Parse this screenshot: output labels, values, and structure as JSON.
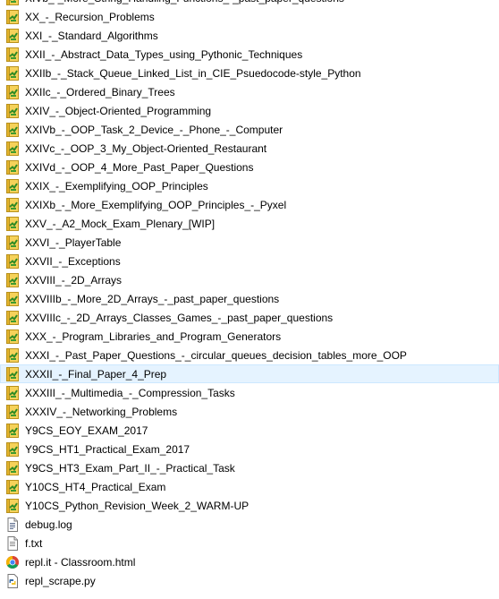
{
  "files": [
    {
      "name": "XIVb_-_More_String_Handling_Functions_-_past_paper_questions",
      "icon": "notebook-icon",
      "selected": false
    },
    {
      "name": "XX_-_Recursion_Problems",
      "icon": "notebook-icon",
      "selected": false
    },
    {
      "name": "XXI_-_Standard_Algorithms",
      "icon": "notebook-icon",
      "selected": false
    },
    {
      "name": "XXII_-_Abstract_Data_Types_using_Pythonic_Techniques",
      "icon": "notebook-icon",
      "selected": false
    },
    {
      "name": "XXIIb_-_Stack_Queue_Linked_List_in_CIE_Psuedocode-style_Python",
      "icon": "notebook-icon",
      "selected": false
    },
    {
      "name": "XXIIc_-_Ordered_Binary_Trees",
      "icon": "notebook-icon",
      "selected": false
    },
    {
      "name": "XXIV_-_Object-Oriented_Programming",
      "icon": "notebook-icon",
      "selected": false
    },
    {
      "name": "XXIVb_-_OOP_Task_2_Device_-_Phone_-_Computer",
      "icon": "notebook-icon",
      "selected": false
    },
    {
      "name": "XXIVc_-_OOP_3_My_Object-Oriented_Restaurant",
      "icon": "notebook-icon",
      "selected": false
    },
    {
      "name": "XXIVd_-_OOP_4_More_Past_Paper_Questions",
      "icon": "notebook-icon",
      "selected": false
    },
    {
      "name": "XXIX_-_Exemplifying_OOP_Principles",
      "icon": "notebook-icon",
      "selected": false
    },
    {
      "name": "XXIXb_-_More_Exemplifying_OOP_Principles_-_Pyxel",
      "icon": "notebook-icon",
      "selected": false
    },
    {
      "name": "XXV_-_A2_Mock_Exam_Plenary_[WIP]",
      "icon": "notebook-icon",
      "selected": false
    },
    {
      "name": "XXVI_-_PlayerTable",
      "icon": "notebook-icon",
      "selected": false
    },
    {
      "name": "XXVII_-_Exceptions",
      "icon": "notebook-icon",
      "selected": false
    },
    {
      "name": "XXVIII_-_2D_Arrays",
      "icon": "notebook-icon",
      "selected": false
    },
    {
      "name": "XXVIIIb_-_More_2D_Arrays_-_past_paper_questions",
      "icon": "notebook-icon",
      "selected": false
    },
    {
      "name": "XXVIIIc_-_2D_Arrays_Classes_Games_-_past_paper_questions",
      "icon": "notebook-icon",
      "selected": false
    },
    {
      "name": "XXX_-_Program_Libraries_and_Program_Generators",
      "icon": "notebook-icon",
      "selected": false
    },
    {
      "name": "XXXI_-_Past_Paper_Questions_-_circular_queues_decision_tables_more_OOP",
      "icon": "notebook-icon",
      "selected": false
    },
    {
      "name": "XXXII_-_Final_Paper_4_Prep",
      "icon": "notebook-icon",
      "selected": true
    },
    {
      "name": "XXXIII_-_Multimedia_-_Compression_Tasks",
      "icon": "notebook-icon",
      "selected": false
    },
    {
      "name": "XXXIV_-_Networking_Problems",
      "icon": "notebook-icon",
      "selected": false
    },
    {
      "name": "Y9CS_EOY_EXAM_2017",
      "icon": "notebook-icon",
      "selected": false
    },
    {
      "name": "Y9CS_HT1_Practical_Exam_2017",
      "icon": "notebook-icon",
      "selected": false
    },
    {
      "name": "Y9CS_HT3_Exam_Part_II_-_Practical_Task",
      "icon": "notebook-icon",
      "selected": false
    },
    {
      "name": "Y10CS_HT4_Practical_Exam",
      "icon": "notebook-icon",
      "selected": false
    },
    {
      "name": "Y10CS_Python_Revision_Week_2_WARM-UP",
      "icon": "notebook-icon",
      "selected": false
    },
    {
      "name": "debug.log",
      "icon": "log-file-icon",
      "selected": false
    },
    {
      "name": "f.txt",
      "icon": "text-file-icon",
      "selected": false
    },
    {
      "name": "repl.it - Classroom.html",
      "icon": "chrome-html-icon",
      "selected": false
    },
    {
      "name": "repl_scrape.py",
      "icon": "python-file-icon",
      "selected": false
    }
  ],
  "colors": {
    "selected_row_bg": "#e5f3ff",
    "selected_row_border": "#cce8ff",
    "notebook_green": "#3f9b2f",
    "notebook_yellow": "#f4c33e"
  }
}
